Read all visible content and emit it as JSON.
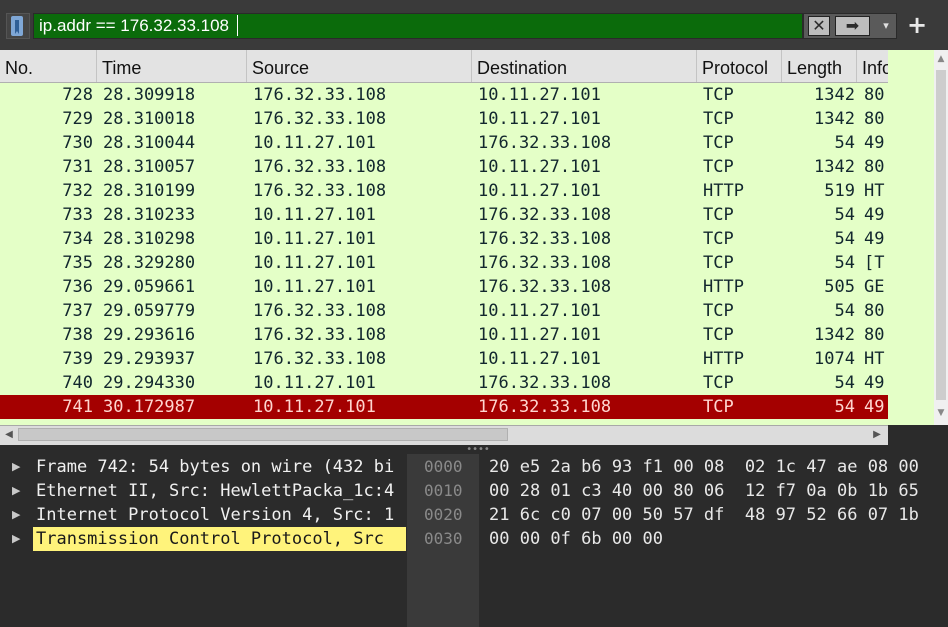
{
  "filter": {
    "value": "ip.addr == 176.32.33.108",
    "clear_icon": "✕",
    "apply_icon": "➡",
    "recent_icon": "▾",
    "add_icon": "+"
  },
  "columns": [
    "No.",
    "Time",
    "Source",
    "Destination",
    "Protocol",
    "Length",
    "Info"
  ],
  "packets": [
    {
      "no": "728",
      "time": "28.309918",
      "src": "176.32.33.108",
      "dst": "10.11.27.101",
      "proto": "TCP",
      "len": "1342",
      "info": "80"
    },
    {
      "no": "729",
      "time": "28.310018",
      "src": "176.32.33.108",
      "dst": "10.11.27.101",
      "proto": "TCP",
      "len": "1342",
      "info": "80"
    },
    {
      "no": "730",
      "time": "28.310044",
      "src": "10.11.27.101",
      "dst": "176.32.33.108",
      "proto": "TCP",
      "len": "54",
      "info": "49"
    },
    {
      "no": "731",
      "time": "28.310057",
      "src": "176.32.33.108",
      "dst": "10.11.27.101",
      "proto": "TCP",
      "len": "1342",
      "info": "80"
    },
    {
      "no": "732",
      "time": "28.310199",
      "src": "176.32.33.108",
      "dst": "10.11.27.101",
      "proto": "HTTP",
      "len": "519",
      "info": "HT"
    },
    {
      "no": "733",
      "time": "28.310233",
      "src": "10.11.27.101",
      "dst": "176.32.33.108",
      "proto": "TCP",
      "len": "54",
      "info": "49"
    },
    {
      "no": "734",
      "time": "28.310298",
      "src": "10.11.27.101",
      "dst": "176.32.33.108",
      "proto": "TCP",
      "len": "54",
      "info": "49"
    },
    {
      "no": "735",
      "time": "28.329280",
      "src": "10.11.27.101",
      "dst": "176.32.33.108",
      "proto": "TCP",
      "len": "54",
      "info": "[T"
    },
    {
      "no": "736",
      "time": "29.059661",
      "src": "10.11.27.101",
      "dst": "176.32.33.108",
      "proto": "HTTP",
      "len": "505",
      "info": "GE"
    },
    {
      "no": "737",
      "time": "29.059779",
      "src": "176.32.33.108",
      "dst": "10.11.27.101",
      "proto": "TCP",
      "len": "54",
      "info": "80"
    },
    {
      "no": "738",
      "time": "29.293616",
      "src": "176.32.33.108",
      "dst": "10.11.27.101",
      "proto": "TCP",
      "len": "1342",
      "info": "80"
    },
    {
      "no": "739",
      "time": "29.293937",
      "src": "176.32.33.108",
      "dst": "10.11.27.101",
      "proto": "HTTP",
      "len": "1074",
      "info": "HT"
    },
    {
      "no": "740",
      "time": "29.294330",
      "src": "10.11.27.101",
      "dst": "176.32.33.108",
      "proto": "TCP",
      "len": "54",
      "info": "49"
    },
    {
      "no": "741",
      "time": "30.172987",
      "src": "10.11.27.101",
      "dst": "176.32.33.108",
      "proto": "TCP",
      "len": "54",
      "info": "49",
      "selected": true
    }
  ],
  "details": [
    {
      "label": "Frame 742: 54 bytes on wire (432 bi"
    },
    {
      "label": "Ethernet II, Src: HewlettPacka_1c:4"
    },
    {
      "label": "Internet Protocol Version 4, Src: 1"
    },
    {
      "label": "Transmission Control Protocol, Src",
      "highlighted": true
    }
  ],
  "bytes": [
    {
      "offset": "0000",
      "hex": "20 e5 2a b6 93 f1 00 08  02 1c 47 ae 08 00"
    },
    {
      "offset": "0010",
      "hex": "00 28 01 c3 40 00 80 06  12 f7 0a 0b 1b 65"
    },
    {
      "offset": "0020",
      "hex": "21 6c c0 07 00 50 57 df  48 97 52 66 07 1b"
    },
    {
      "offset": "0030",
      "hex": "00 00 0f 6b 00 00"
    }
  ],
  "colors": {
    "filter_valid_bg": "#0b6b0b",
    "row_bg": "#e4ffc7",
    "selected_row_bg": "#a40000",
    "selected_row_text": "#ffd5cf",
    "detail_highlight": "#fff37b"
  }
}
